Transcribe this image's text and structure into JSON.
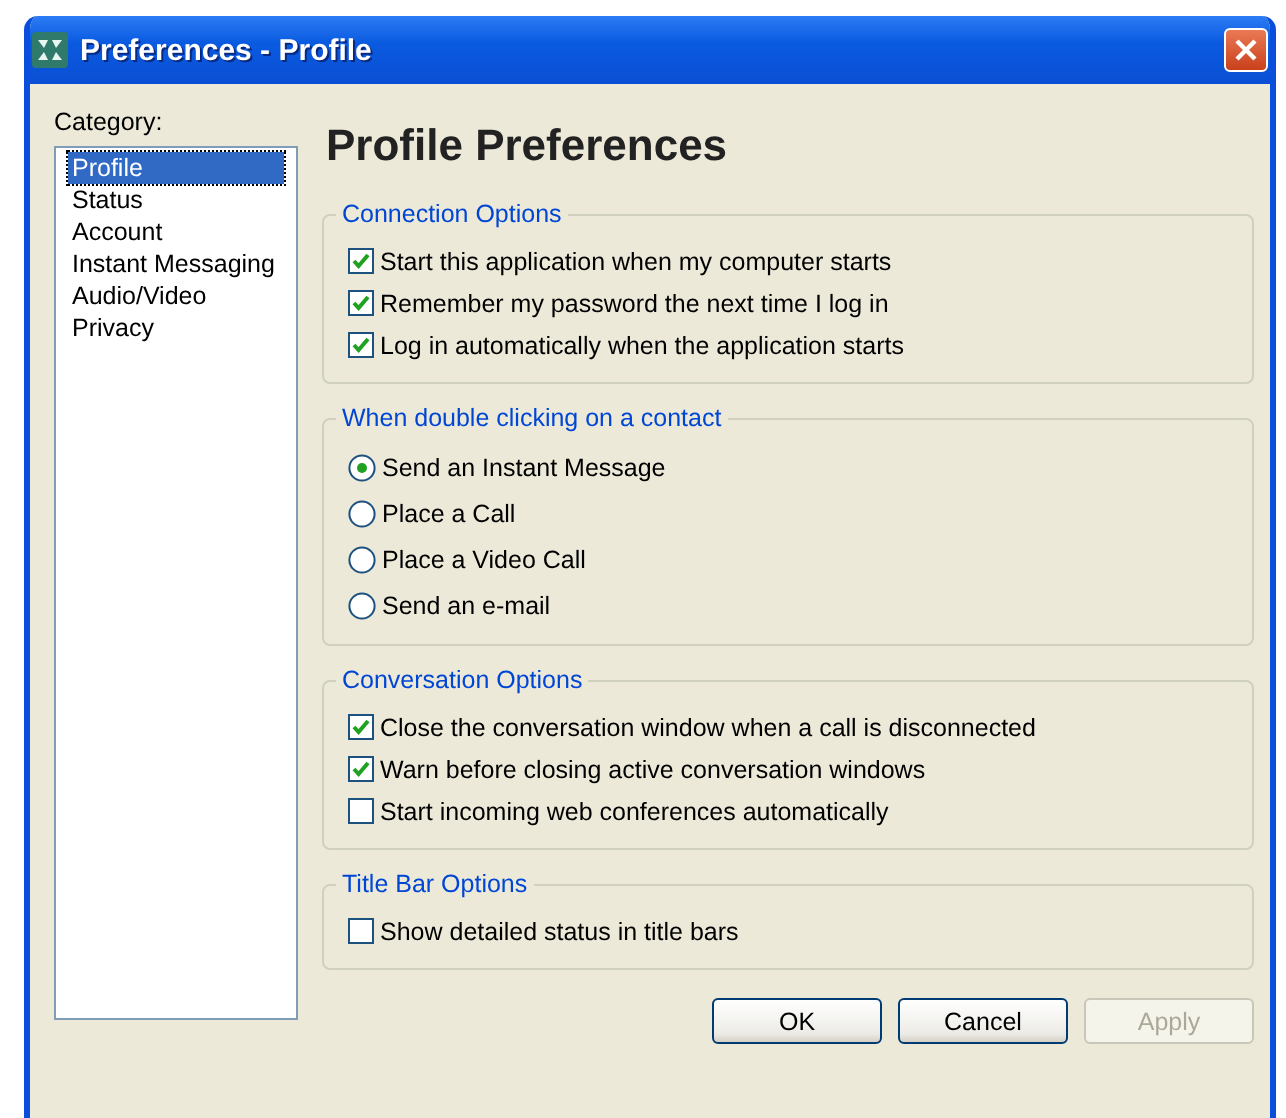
{
  "window": {
    "title": "Preferences - Profile"
  },
  "category": {
    "label": "Category:",
    "items": [
      {
        "label": "Profile",
        "selected": true
      },
      {
        "label": "Status",
        "selected": false
      },
      {
        "label": "Account",
        "selected": false
      },
      {
        "label": "Instant Messaging",
        "selected": false
      },
      {
        "label": "Audio/Video",
        "selected": false
      },
      {
        "label": "Privacy",
        "selected": false
      }
    ]
  },
  "heading": "Profile Preferences",
  "groups": [
    {
      "title": "Connection Options",
      "options": [
        {
          "kind": "checkbox",
          "label": "Start this application when my computer starts",
          "checked": true
        },
        {
          "kind": "checkbox",
          "label": "Remember my password the next time I log in",
          "checked": true
        },
        {
          "kind": "checkbox",
          "label": "Log in automatically when the application starts",
          "checked": true
        }
      ]
    },
    {
      "title": "When double clicking on a contact",
      "options": [
        {
          "kind": "radio",
          "label": "Send an Instant Message",
          "selected": true
        },
        {
          "kind": "radio",
          "label": "Place a Call",
          "selected": false
        },
        {
          "kind": "radio",
          "label": "Place a Video Call",
          "selected": false
        },
        {
          "kind": "radio",
          "label": "Send an e-mail",
          "selected": false
        }
      ]
    },
    {
      "title": "Conversation Options",
      "options": [
        {
          "kind": "checkbox",
          "label": "Close the conversation window when a call is disconnected",
          "checked": true
        },
        {
          "kind": "checkbox",
          "label": "Warn before closing active conversation windows",
          "checked": true
        },
        {
          "kind": "checkbox",
          "label": "Start incoming web conferences automatically",
          "checked": false
        }
      ]
    },
    {
      "title": "Title Bar Options",
      "options": [
        {
          "kind": "checkbox",
          "label": "Show detailed status in title bars",
          "checked": false
        }
      ]
    }
  ],
  "buttons": [
    {
      "label": "OK",
      "disabled": false
    },
    {
      "label": "Cancel",
      "disabled": false
    },
    {
      "label": "Apply",
      "disabled": true
    }
  ]
}
